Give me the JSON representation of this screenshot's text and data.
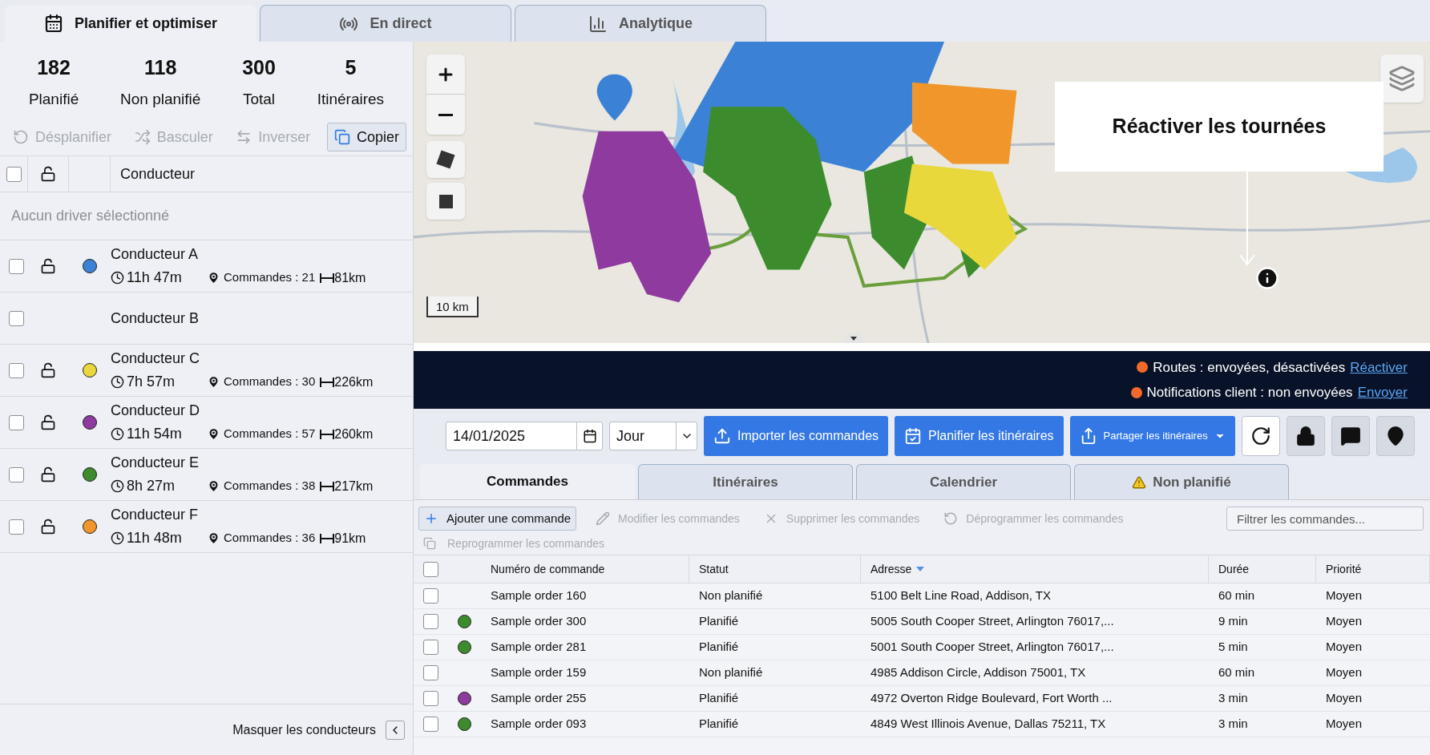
{
  "top_tabs": [
    {
      "label": "Planifier et optimiser",
      "selected": true
    },
    {
      "label": "En direct",
      "selected": false
    },
    {
      "label": "Analytique",
      "selected": false
    }
  ],
  "summary": [
    {
      "value": "182",
      "label": "Planifié"
    },
    {
      "value": "118",
      "label": "Non planifié"
    },
    {
      "value": "300",
      "label": "Total"
    },
    {
      "value": "5",
      "label": "Itinéraires"
    }
  ],
  "driver_actions": [
    {
      "label": "Désplanifier",
      "disabled": true
    },
    {
      "label": "Basculer",
      "disabled": true
    },
    {
      "label": "Inverser",
      "disabled": true
    },
    {
      "label": "Copier",
      "disabled": false
    }
  ],
  "drivers_table": {
    "header": "Conducteur",
    "select_all_checked": false,
    "empty_message": "Aucun driver sélectionné",
    "rows": [
      {
        "kind": "detailed",
        "name": "Conducteur A",
        "checked": false,
        "color": "#3b82d6",
        "duration": "11h 47m",
        "orders": "Commandes : 21",
        "distance": "81km"
      },
      {
        "kind": "plain",
        "name": "Conducteur B",
        "checked": false
      },
      {
        "kind": "detailed",
        "name": "Conducteur C",
        "checked": false,
        "color": "#e9d83c",
        "duration": "7h 57m",
        "orders": "Commandes : 30",
        "distance": "226km"
      },
      {
        "kind": "detailed",
        "name": "Conducteur D",
        "checked": false,
        "color": "#8e3a9e",
        "duration": "11h 54m",
        "orders": "Commandes : 57",
        "distance": "260km"
      },
      {
        "kind": "detailed",
        "name": "Conducteur E",
        "checked": false,
        "color": "#3c8c2e",
        "duration": "8h 27m",
        "orders": "Commandes : 38",
        "distance": "217km"
      },
      {
        "kind": "detailed",
        "name": "Conducteur F",
        "checked": false,
        "color": "#f0962b",
        "duration": "11h 48m",
        "orders": "Commandes : 36",
        "distance": "91km"
      }
    ]
  },
  "hide_drivers": "Masquer les conducteurs",
  "map": {
    "scale": "10 km",
    "callout": "Réactiver les tournées"
  },
  "banner": [
    {
      "text": "Routes : envoyées, désactivées",
      "link": "Réactiver"
    },
    {
      "text": "Notifications client : non envoyées",
      "link": "Envoyer"
    }
  ],
  "toolbar": {
    "date": "14/01/2025",
    "period": "Jour",
    "buttons": [
      "Importer les commandes",
      "Planifier les itinéraires",
      "Partager les itinéraires"
    ]
  },
  "order_tabs": [
    {
      "label": "Commandes",
      "selected": true,
      "warning": false
    },
    {
      "label": "Itinéraires",
      "selected": false,
      "warning": false
    },
    {
      "label": "Calendrier",
      "selected": false,
      "warning": false
    },
    {
      "label": "Non planifié",
      "selected": false,
      "warning": true
    }
  ],
  "order_actions": [
    {
      "label": "Ajouter une commande",
      "disabled": false
    },
    {
      "label": "Modifier les commandes",
      "disabled": true
    },
    {
      "label": "Supprimer les commandes",
      "disabled": true
    },
    {
      "label": "Déprogrammer les commandes",
      "disabled": true
    },
    {
      "label": "Reprogrammer les commandes",
      "disabled": true
    }
  ],
  "filter": {
    "placeholder": "Filtrer les commandes..."
  },
  "table": {
    "select_all_checked": false,
    "columns": [
      "Numéro de commande",
      "Statut",
      "Adresse",
      "Durée",
      "Priorité"
    ],
    "rows": [
      {
        "checked": false,
        "order": "Sample order 160",
        "status": "Non planifié",
        "address": "5100 Belt Line Road, Addison, TX",
        "duration": "60 min",
        "priority": "Moyen"
      },
      {
        "checked": false,
        "color": "#3c8c2e",
        "order": "Sample order 300",
        "status": "Planifié",
        "address": "5005 South Cooper Street, Arlington 76017,...",
        "duration": "9 min",
        "priority": "Moyen"
      },
      {
        "checked": false,
        "color": "#3c8c2e",
        "order": "Sample order 281",
        "status": "Planifié",
        "address": "5001 South Cooper Street, Arlington 76017,...",
        "duration": "5 min",
        "priority": "Moyen"
      },
      {
        "checked": false,
        "order": "Sample order 159",
        "status": "Non planifié",
        "address": "4985 Addison Circle, Addison 75001, TX",
        "duration": "60 min",
        "priority": "Moyen"
      },
      {
        "checked": false,
        "color": "#8e3a9e",
        "order": "Sample order 255",
        "status": "Planifié",
        "address": "4972 Overton Ridge Boulevard, Fort Worth ...",
        "duration": "3 min",
        "priority": "Moyen"
      },
      {
        "checked": false,
        "color": "#3c8c2e",
        "order": "Sample order 093",
        "status": "Planifié",
        "address": "4849 West Illinois Avenue, Dallas 75211, TX",
        "duration": "3 min",
        "priority": "Moyen"
      }
    ]
  }
}
